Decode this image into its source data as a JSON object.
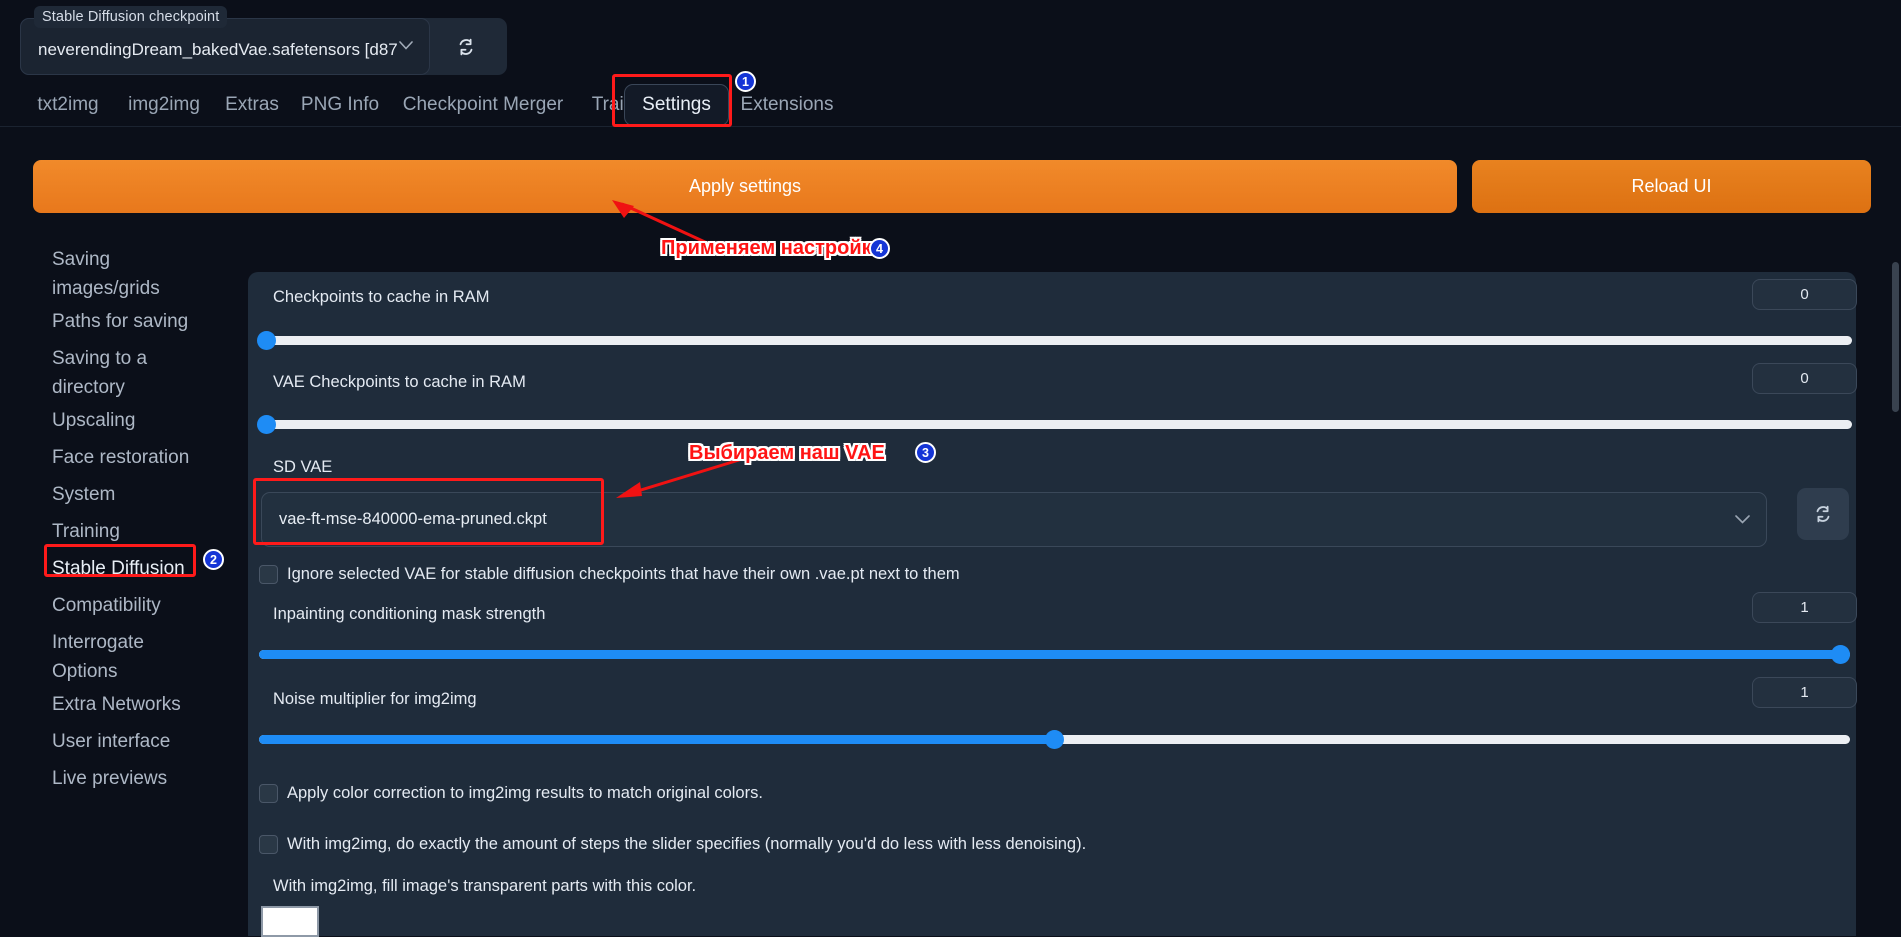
{
  "topbar": {
    "checkpoint_label": "Stable Diffusion checkpoint",
    "checkpoint_value": "neverendingDream_bakedVae.safetensors [d87",
    "refresh_icon": "refresh-icon"
  },
  "tabs": [
    {
      "label": "txt2img",
      "selected": false
    },
    {
      "label": "img2img",
      "selected": false
    },
    {
      "label": "Extras",
      "selected": false
    },
    {
      "label": "PNG Info",
      "selected": false
    },
    {
      "label": "Checkpoint Merger",
      "selected": false
    },
    {
      "label": "Train",
      "selected": false
    },
    {
      "label": "Settings",
      "selected": true
    },
    {
      "label": "Extensions",
      "selected": false
    }
  ],
  "actions": {
    "apply_label": "Apply settings",
    "reload_label": "Reload UI"
  },
  "sidebar": {
    "items": [
      {
        "label": "Saving\nimages/grids",
        "active": false
      },
      {
        "label": "Paths for saving",
        "active": false
      },
      {
        "label": "Saving to a\ndirectory",
        "active": false
      },
      {
        "label": "Upscaling",
        "active": false
      },
      {
        "label": "Face restoration",
        "active": false
      },
      {
        "label": "System",
        "active": false
      },
      {
        "label": "Training",
        "active": false
      },
      {
        "label": "Stable Diffusion",
        "active": true
      },
      {
        "label": "Compatibility",
        "active": false
      },
      {
        "label": "Interrogate\nOptions",
        "active": false
      },
      {
        "label": "Extra Networks",
        "active": false
      },
      {
        "label": "User interface",
        "active": false
      },
      {
        "label": "Live previews",
        "active": false
      }
    ]
  },
  "settings": {
    "checkpoints_cache": {
      "label": "Checkpoints to cache in RAM",
      "value": "0",
      "percent": 0
    },
    "vae_checkpoints_cache": {
      "label": "VAE Checkpoints to cache in RAM",
      "value": "0",
      "percent": 0
    },
    "sd_vae": {
      "label": "SD VAE",
      "value": "vae-ft-mse-840000-ema-pruned.ckpt",
      "refresh_icon": "refresh-icon",
      "caret_icon": "chevron-down-icon"
    },
    "ignore_vae": {
      "label": "Ignore selected VAE for stable diffusion checkpoints that have their own .vae.pt next to them",
      "checked": false
    },
    "inpainting_mask_strength": {
      "label": "Inpainting conditioning mask strength",
      "value": "1",
      "percent": 100
    },
    "noise_multiplier": {
      "label": "Noise multiplier for img2img",
      "value": "1",
      "percent": 50
    },
    "color_correction": {
      "label": "Apply color correction to img2img results to match original colors.",
      "checked": false
    },
    "exact_steps": {
      "label": "With img2img, do exactly the amount of steps the slider specifies (normally you'd do less with less denoising).",
      "checked": false
    },
    "transparent_fill": {
      "label": "With img2img, fill image's transparent parts with this color.",
      "color": "#ffffff"
    }
  },
  "annotations": {
    "apply_note": "Применяем настройки",
    "apply_badge": "4",
    "vae_note": "Выбираем наш VAE",
    "vae_badge": "3",
    "settings_badge": "1",
    "sidebar_badge": "2",
    "highlight_color": "#ff1a1a",
    "badge_color": "#1535d6"
  }
}
